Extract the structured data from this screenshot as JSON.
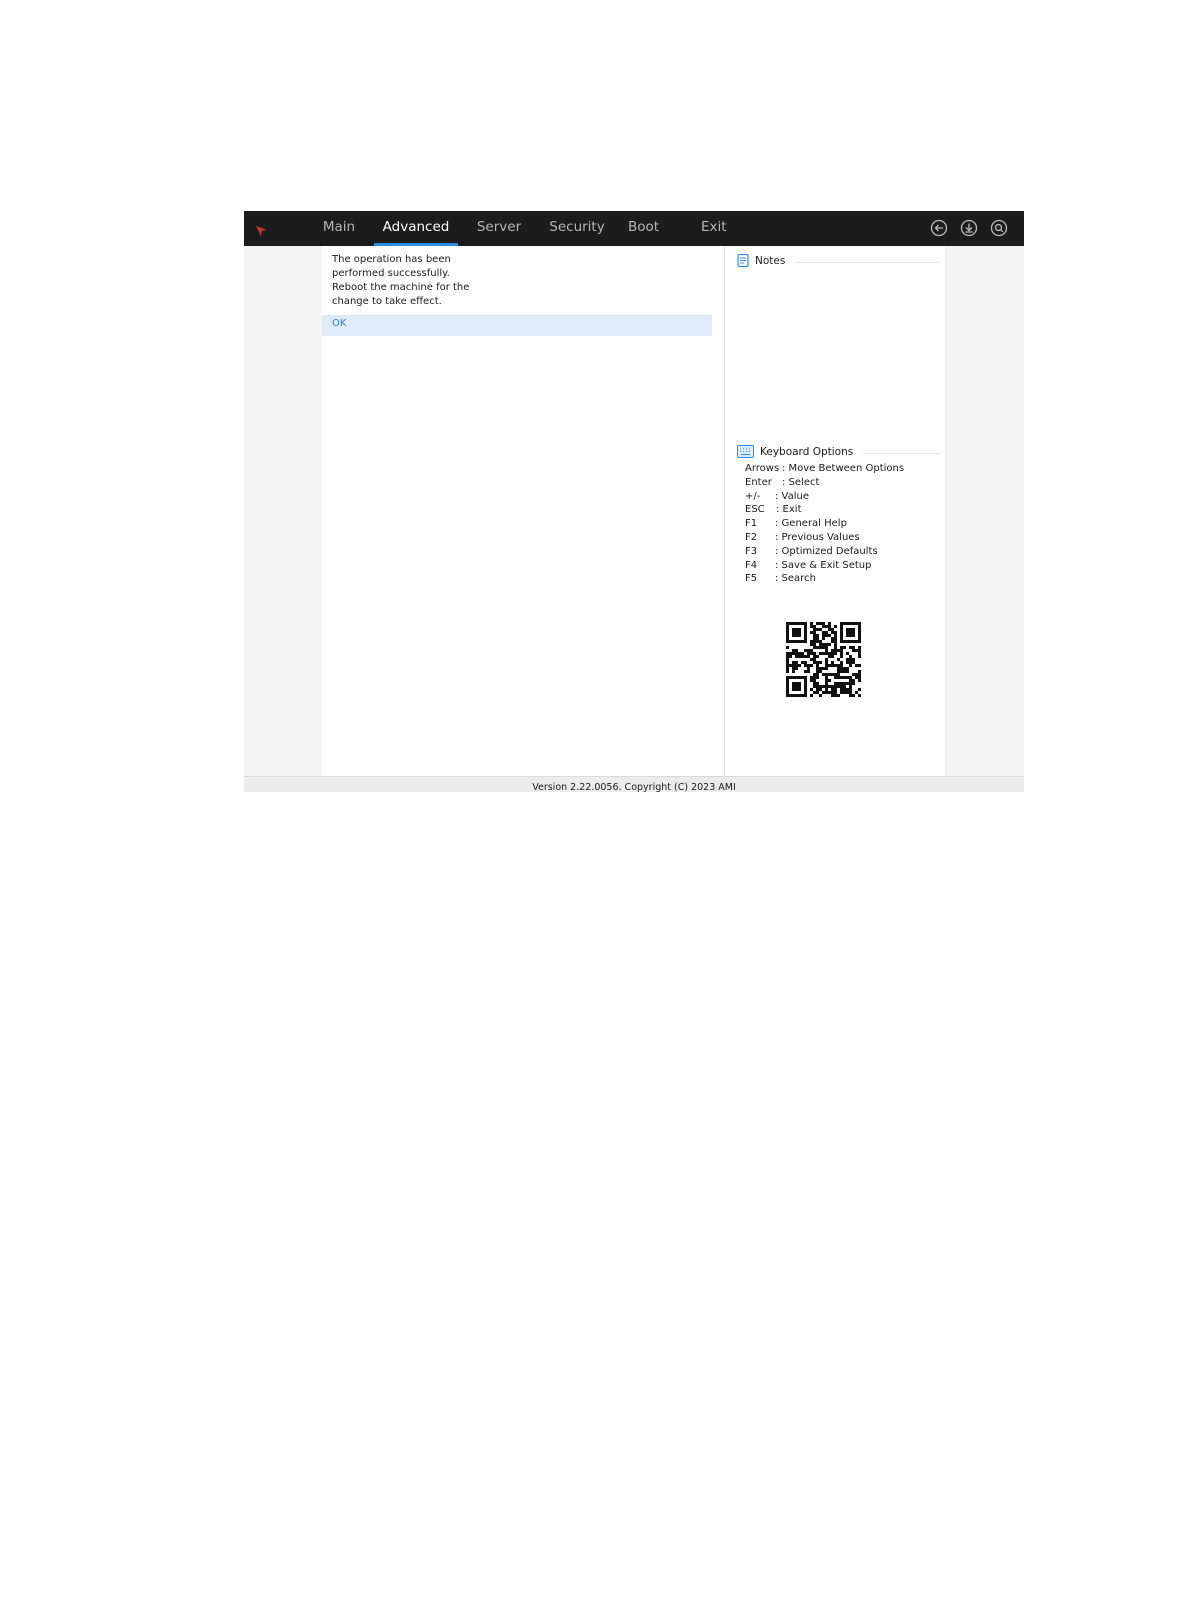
{
  "topbar": {
    "tabs": [
      {
        "label": "Main",
        "active": false
      },
      {
        "label": "Advanced",
        "active": true
      },
      {
        "label": "Server",
        "active": false
      },
      {
        "label": "Security",
        "active": false
      },
      {
        "label": "Boot",
        "active": false
      },
      {
        "label": "Exit",
        "active": false
      }
    ],
    "icons": [
      "back-icon",
      "save-icon",
      "search-icon"
    ],
    "accent_color": "#2b8fe6",
    "logo_color": "#c0392b"
  },
  "dialog": {
    "message_lines": [
      "The operation has been",
      "performed successfully.",
      "Reboot the machine for the",
      "change to take effect."
    ],
    "ok_label": "OK"
  },
  "notes": {
    "title": "Notes",
    "icon": "notes-icon"
  },
  "keyboard": {
    "title": "Keyboard Options",
    "icon": "keyboard-icon",
    "items": [
      {
        "key": "Arrows",
        "desc": ": Move Between Options"
      },
      {
        "key": "Enter",
        "desc": ": Select"
      },
      {
        "key": "+/-",
        "desc": ": Value"
      },
      {
        "key": "ESC",
        "desc": ": Exit"
      },
      {
        "key": "F1",
        "desc": ": General Help"
      },
      {
        "key": "F2",
        "desc": ": Previous Values"
      },
      {
        "key": "F3",
        "desc": ": Optimized Defaults"
      },
      {
        "key": "F4",
        "desc": ": Save & Exit Setup"
      },
      {
        "key": "F5",
        "desc": ": Search"
      }
    ]
  },
  "footer": {
    "text": "Version 2.22.0056. Copyright (C) 2023 AMI"
  }
}
